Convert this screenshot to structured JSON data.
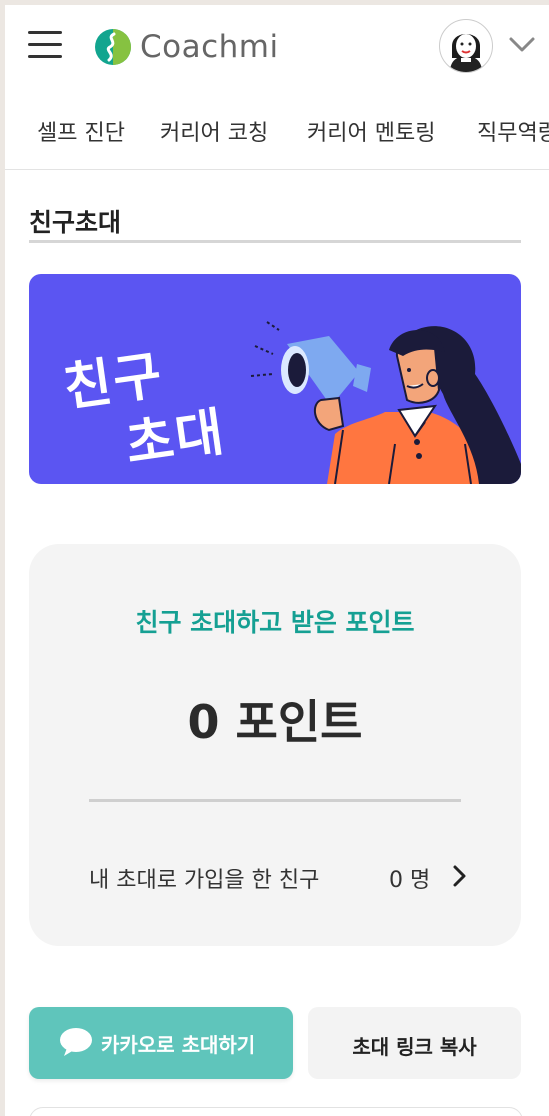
{
  "header": {
    "logo_text": "Coachmi",
    "icons": [
      "hamburger-menu-icon",
      "logo-mark-icon",
      "user-avatar",
      "chevron-down-icon"
    ]
  },
  "nav": {
    "items": [
      {
        "label": "셀프 진단"
      },
      {
        "label": "커리어 코칭"
      },
      {
        "label": "커리어 멘토링"
      },
      {
        "label": "직무역량"
      }
    ]
  },
  "page": {
    "title": "친구초대"
  },
  "banner": {
    "line1": "친구",
    "line2": "초대",
    "background": "#5b55f2"
  },
  "points_card": {
    "label": "친구 초대하고 받은 포인트",
    "value": "0 포인트",
    "invited_label": "내 초대로 가입을 한 친구",
    "invited_count": "0 명"
  },
  "actions": {
    "kakao_label": "카카오로 초대하기",
    "copy_label": "초대 링크 복사"
  },
  "colors": {
    "accent_teal": "#15a093",
    "kakao_button": "#5fc5bb",
    "banner_purple": "#5b55f2"
  }
}
